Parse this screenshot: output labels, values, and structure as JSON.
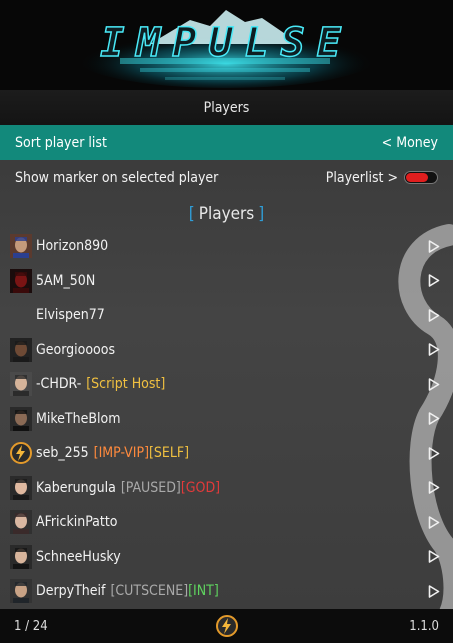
{
  "banner": {
    "logo_text": "IMPULSE"
  },
  "header": {
    "title": "Players"
  },
  "options": {
    "sort": {
      "label": "Sort player list",
      "value": "< Money"
    },
    "marker": {
      "label": "Show marker on selected player",
      "value": "Playerlist >",
      "toggle_on": false
    }
  },
  "section": {
    "open": "[",
    "title": "Players",
    "close": "]"
  },
  "players": [
    {
      "name": "Horizon890",
      "avatar": "flag-face",
      "tags": []
    },
    {
      "name": "5AM_50N",
      "avatar": "red-mask",
      "tags": []
    },
    {
      "name": "Elvispen77",
      "avatar": "none",
      "tags": []
    },
    {
      "name": "Georgioooos",
      "avatar": "dark-face",
      "tags": []
    },
    {
      "name": "-CHDR-",
      "avatar": "white-face",
      "tags": [
        {
          "text": "[Script Host]",
          "color": "#f0c040"
        }
      ]
    },
    {
      "name": "MikeTheBlom",
      "avatar": "masked-face",
      "tags": []
    },
    {
      "name": "seb_255",
      "avatar": "impulse-logo",
      "tags": [
        {
          "text": "[IMP-VIP]",
          "color": "#ff8a3d"
        },
        {
          "text": "[SELF]",
          "color": "#f0c040"
        }
      ]
    },
    {
      "name": "Kaberungula",
      "avatar": "woman-face",
      "tags": [
        {
          "text": "[PAUSED]",
          "color": "#a9a9a9"
        },
        {
          "text": "[GOD]",
          "color": "#e23a3a"
        }
      ]
    },
    {
      "name": "AFrickinPatto",
      "avatar": "pale-face",
      "tags": []
    },
    {
      "name": "SchneeHusky",
      "avatar": "hat-face",
      "tags": []
    },
    {
      "name": "DerpyTheif",
      "avatar": "tan-face",
      "tags": [
        {
          "text": "[CUTSCENE]",
          "color": "#a9a9a9"
        },
        {
          "text": "[INT]",
          "color": "#5fd35f"
        }
      ]
    }
  ],
  "footer": {
    "page": "1 / 24",
    "version": "1.1.0"
  },
  "colors": {
    "accent": "#12897b",
    "bracket": "#2f9ed8",
    "toggle_off": "#e01e1e"
  }
}
